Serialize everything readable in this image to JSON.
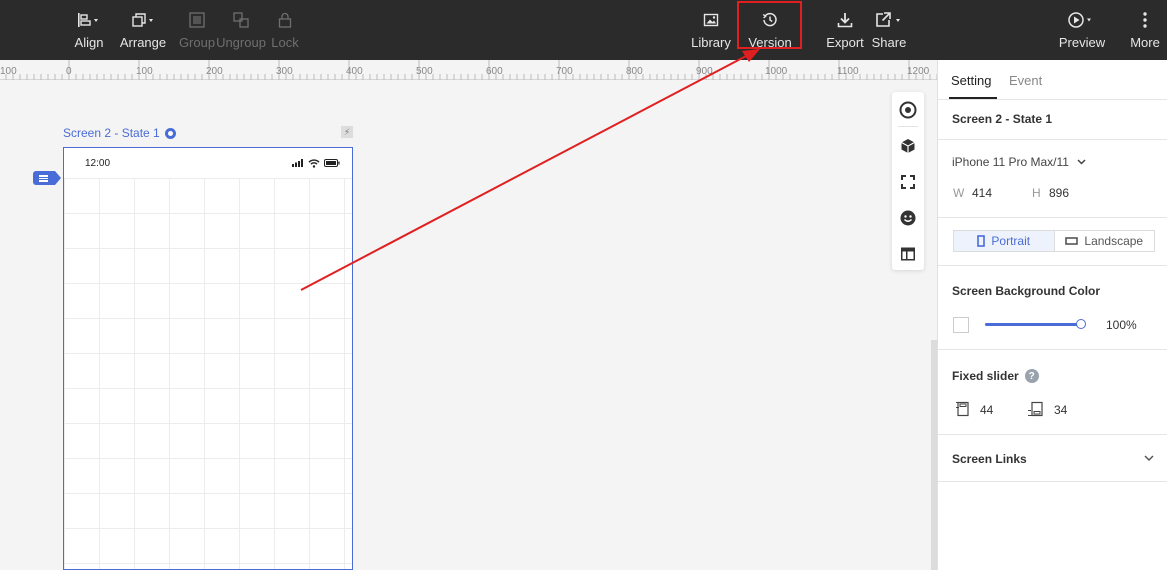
{
  "toolbar": {
    "align": {
      "label": "Align",
      "icon": "align-left-icon"
    },
    "arrange": {
      "label": "Arrange",
      "icon": "arrange-icon"
    },
    "group": {
      "label": "Group",
      "icon": "group-icon"
    },
    "ungroup": {
      "label": "Ungroup",
      "icon": "ungroup-icon"
    },
    "lock": {
      "label": "Lock",
      "icon": "lock-icon"
    },
    "library": {
      "label": "Library",
      "icon": "image-icon"
    },
    "version": {
      "label": "Version",
      "icon": "history-icon"
    },
    "export": {
      "label": "Export",
      "icon": "download-icon"
    },
    "share": {
      "label": "Share",
      "icon": "share-icon"
    },
    "preview": {
      "label": "Preview",
      "icon": "play-icon"
    },
    "more": {
      "label": "More",
      "icon": "more-vertical-icon"
    }
  },
  "ruler": {
    "labels": [
      "100",
      "0",
      "100",
      "200",
      "300",
      "400",
      "500",
      "600",
      "700",
      "800",
      "900",
      "1000",
      "1100",
      "1200"
    ]
  },
  "canvas": {
    "screen_label": "Screen 2 - State 1",
    "flash_glyph": "⚡",
    "status_time": "12:00"
  },
  "panel": {
    "tabs": {
      "setting": "Setting",
      "event": "Event"
    },
    "screen_name": "Screen 2 - State 1",
    "device": "iPhone 11 Pro Max/11",
    "width_label": "W",
    "width_value": "414",
    "height_label": "H",
    "height_value": "896",
    "portrait": "Portrait",
    "landscape": "Landscape",
    "bg_color_title": "Screen Background Color",
    "bg_opacity": "100",
    "bg_opacity_unit": "%",
    "fixed_slider_title": "Fixed slider",
    "help_glyph": "?",
    "fixed_top": "44",
    "fixed_bottom": "34",
    "screen_links_title": "Screen Links"
  },
  "colors": {
    "accent": "#4a6cd6",
    "toolbar_bg": "#2b2b2b",
    "annotation_red": "#e02020"
  }
}
